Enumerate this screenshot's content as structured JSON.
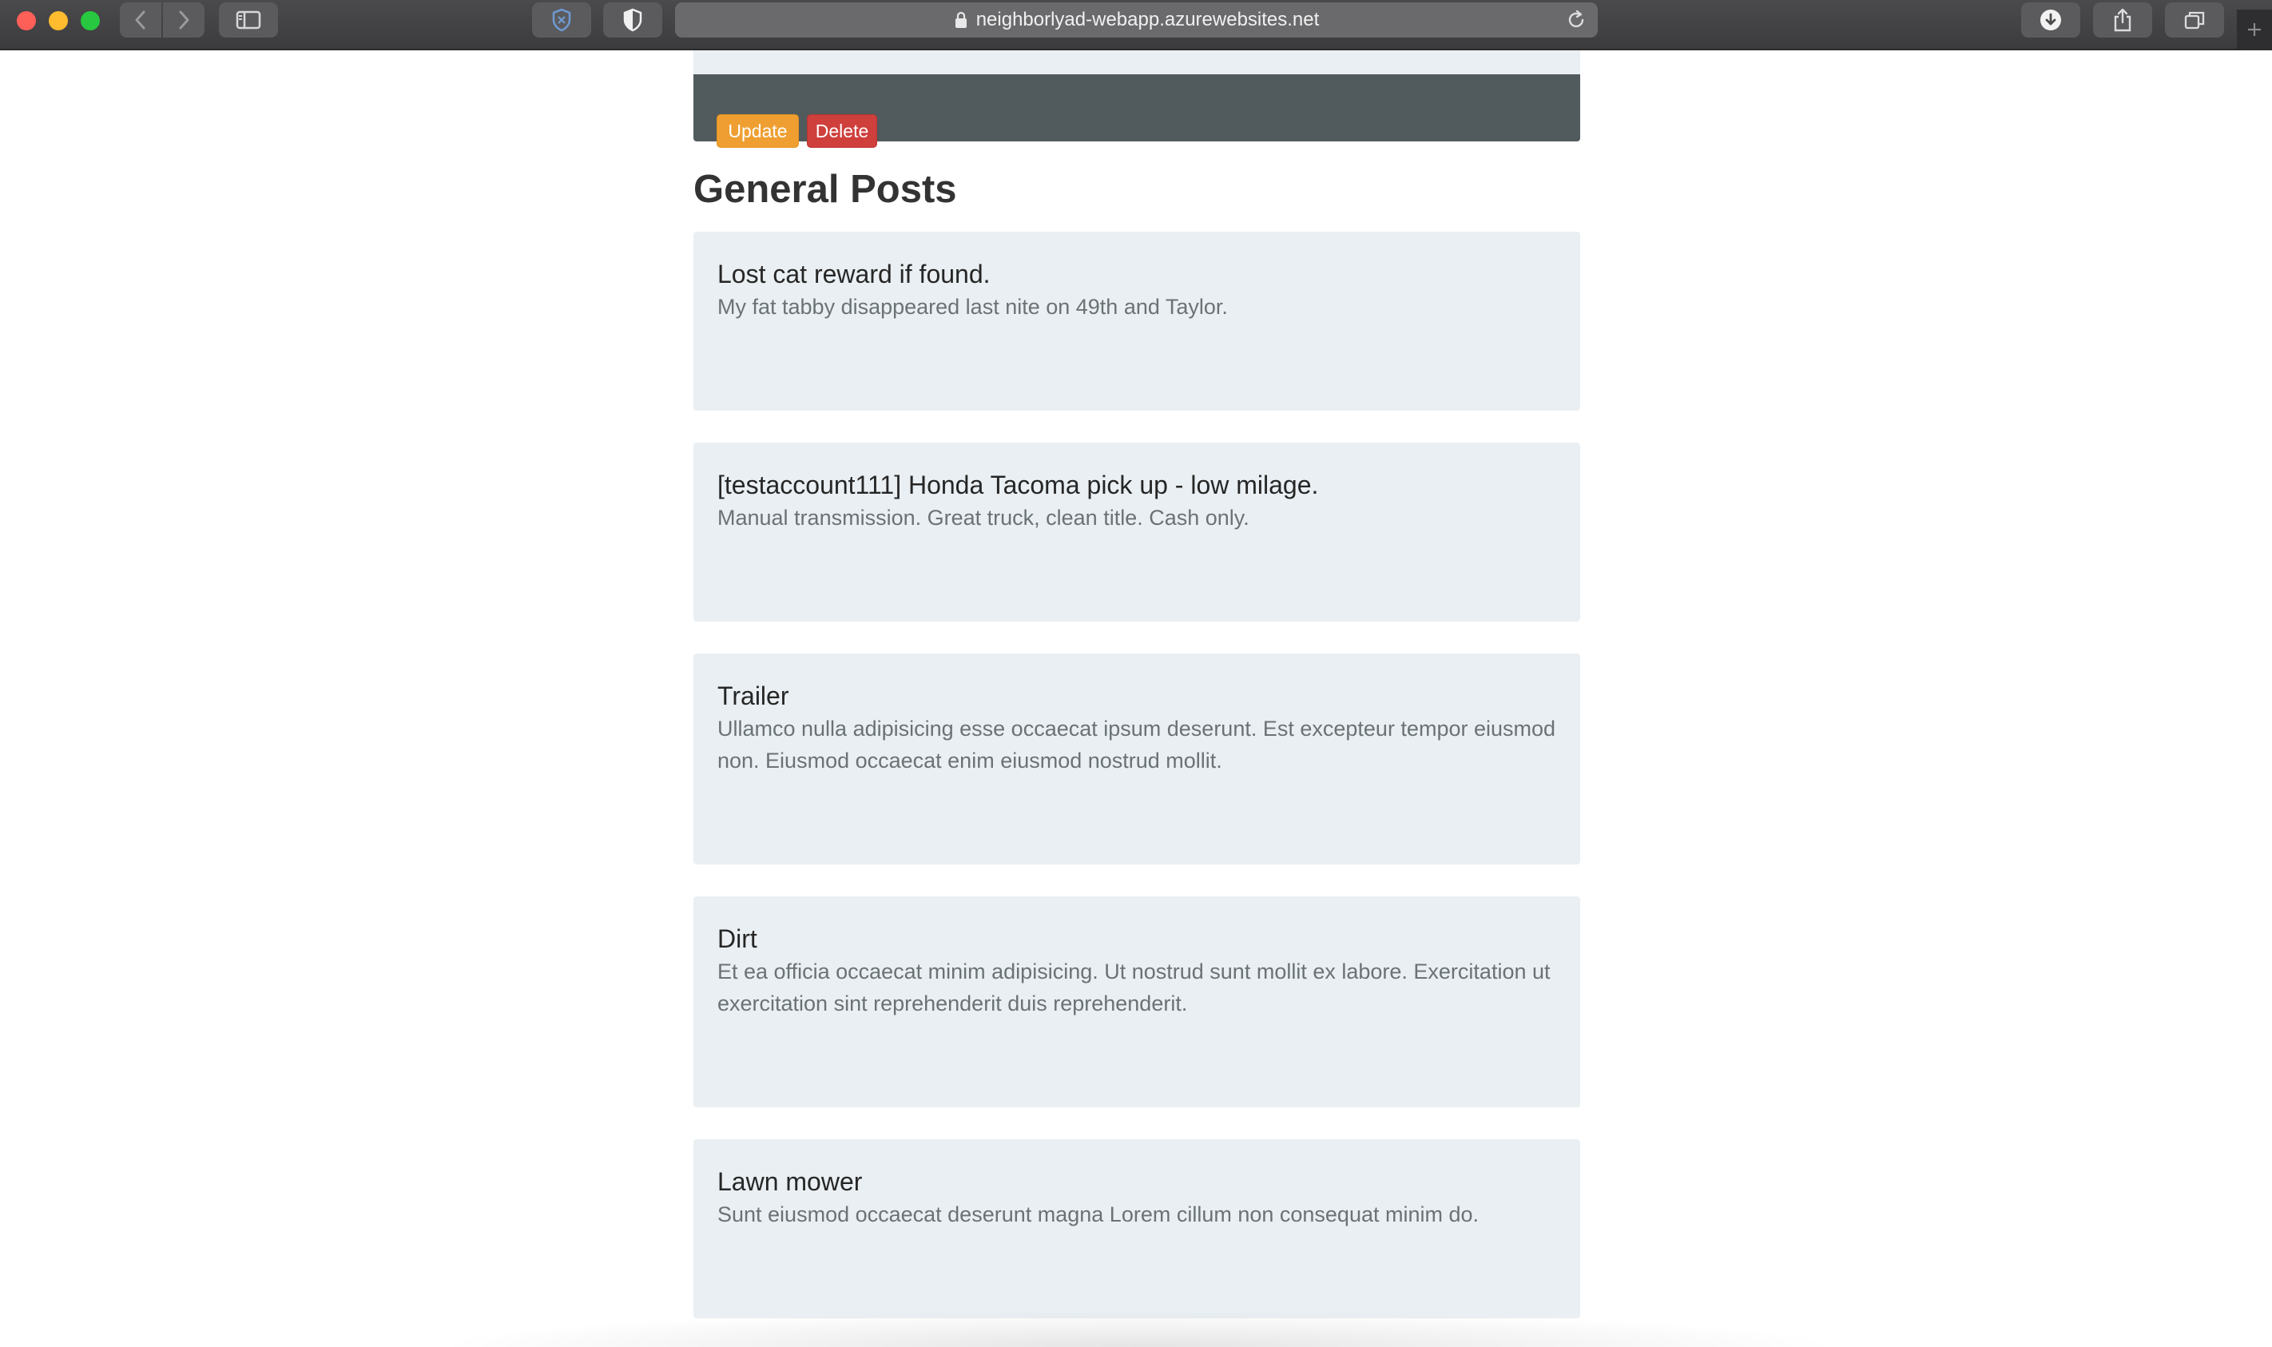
{
  "browser": {
    "url": "neighborlyad-webapp.azurewebsites.net",
    "icons": {
      "back": "chevron-left-icon",
      "forward": "chevron-right-icon",
      "sidebar": "sidebar-icon",
      "extension1": "shield-x-icon",
      "extension2": "half-shield-icon",
      "lock": "lock-icon",
      "reload": "reload-icon",
      "download": "download-icon",
      "share": "share-icon",
      "tabs": "tabs-overview-icon",
      "new_tab": "plus-icon"
    }
  },
  "actions": {
    "update_label": "Update",
    "delete_label": "Delete"
  },
  "section": {
    "title": "General Posts"
  },
  "posts": [
    {
      "title": "Lost cat reward if found.",
      "body": "My fat tabby disappeared last nite on 49th and Taylor."
    },
    {
      "title": "[testaccount111] Honda Tacoma pick up - low milage.",
      "body": "Manual transmission. Great truck, clean title. Cash only."
    },
    {
      "title": "Trailer",
      "body": "Ullamco nulla adipisicing esse occaecat ipsum deserunt. Est excepteur tempor eiusmod non. Eiusmod occaecat enim eiusmod nostrud mollit."
    },
    {
      "title": "Dirt",
      "body": "Et ea officia occaecat minim adipisicing. Ut nostrud sunt mollit ex labore. Exercitation ut exercitation sint reprehenderit duis reprehenderit."
    },
    {
      "title": "Lawn mower",
      "body": "Sunt eiusmod occaecat deserunt magna Lorem cillum non consequat minim do."
    }
  ],
  "colors": {
    "update_button": "#ef9f31",
    "delete_button": "#cf3f3c",
    "panel_dark": "#515a5d",
    "card_background": "#e9eff2"
  }
}
